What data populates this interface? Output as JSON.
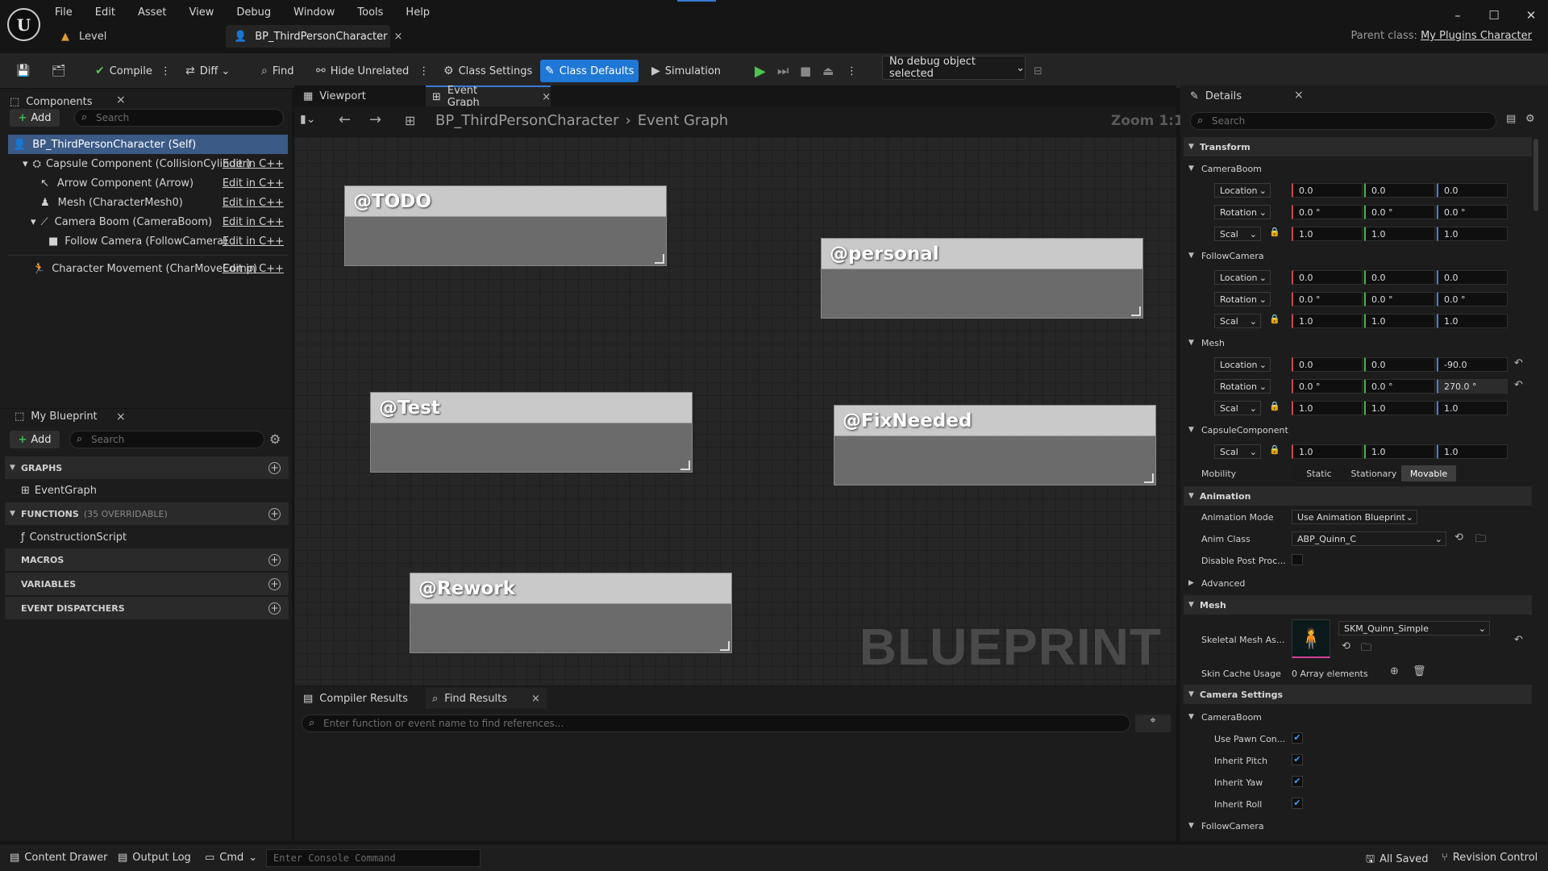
{
  "app": {
    "logo": "U"
  },
  "menu": [
    "File",
    "Edit",
    "Asset",
    "View",
    "Debug",
    "Window",
    "Tools",
    "Help"
  ],
  "doc_tabs": {
    "level": "Level",
    "blueprint": "BP_ThirdPersonCharacter"
  },
  "parent_class": {
    "label": "Parent class:",
    "value": "My Plugins Character"
  },
  "toolbar": {
    "compile": "Compile",
    "diff": "Diff",
    "find": "Find",
    "hide_unrelated": "Hide Unrelated",
    "class_settings": "Class Settings",
    "class_defaults": "Class Defaults",
    "simulation": "Simulation",
    "debug_object": "No debug object selected"
  },
  "components": {
    "tab": "Components",
    "add": "Add",
    "search_placeholder": "Search",
    "root": "BP_ThirdPersonCharacter (Self)",
    "items": [
      {
        "label": "Capsule Component (CollisionCylinder)",
        "edit": "Edit in C++"
      },
      {
        "label": "Arrow Component (Arrow)",
        "edit": "Edit in C++"
      },
      {
        "label": "Mesh (CharacterMesh0)",
        "edit": "Edit in C++"
      },
      {
        "label": "Camera Boom (CameraBoom)",
        "edit": "Edit in C++"
      },
      {
        "label": "Follow Camera (FollowCamera)",
        "edit": "Edit in C++"
      },
      {
        "label": "Character Movement (CharMoveComp)",
        "edit": "Edit in C++"
      }
    ]
  },
  "my_blueprint": {
    "tab": "My Blueprint",
    "add": "Add",
    "search_placeholder": "Search",
    "graphs": "GRAPHS",
    "event_graph": "EventGraph",
    "functions": "FUNCTIONS",
    "functions_note": "(35 OVERRIDABLE)",
    "construction_script": "ConstructionScript",
    "macros": "MACROS",
    "variables": "VARIABLES",
    "event_dispatchers": "EVENT DISPATCHERS"
  },
  "graph_tabs": {
    "viewport": "Viewport",
    "event_graph": "Event Graph"
  },
  "breadcrumb": {
    "bp": "BP_ThirdPersonCharacter",
    "graph": "Event Graph",
    "zoom": "Zoom 1:1"
  },
  "comments": [
    "@TODO",
    "@personal",
    "@Test",
    "@FixNeeded",
    "@Rework"
  ],
  "watermark": "BLUEPRINT",
  "bottom_tabs": {
    "compiler": "Compiler Results",
    "find": "Find Results",
    "find_placeholder": "Enter function or event name to find references..."
  },
  "details": {
    "tab": "Details",
    "search_placeholder": "Search",
    "transform": "Transform",
    "camera_boom": "CameraBoom",
    "follow_camera": "FollowCamera",
    "mesh": "Mesh",
    "capsule": "CapsuleComponent",
    "location": "Location",
    "rotation": "Rotation",
    "scale": "Scal",
    "cb_loc": [
      "0.0",
      "0.0",
      "0.0"
    ],
    "cb_rot": [
      "0.0 °",
      "0.0 °",
      "0.0 °"
    ],
    "cb_scl": [
      "1.0",
      "1.0",
      "1.0"
    ],
    "fc_loc": [
      "0.0",
      "0.0",
      "0.0"
    ],
    "fc_rot": [
      "0.0 °",
      "0.0 °",
      "0.0 °"
    ],
    "fc_scl": [
      "1.0",
      "1.0",
      "1.0"
    ],
    "m_loc": [
      "0.0",
      "0.0",
      "-90.0"
    ],
    "m_rot": [
      "0.0 °",
      "0.0 °",
      "270.0 °"
    ],
    "m_scl": [
      "1.0",
      "1.0",
      "1.0"
    ],
    "c_scl": [
      "1.0",
      "1.0",
      "1.0"
    ],
    "mobility": "Mobility",
    "mobility_opts": [
      "Static",
      "Stationary",
      "Movable"
    ],
    "animation": "Animation",
    "anim_mode_label": "Animation Mode",
    "anim_mode": "Use Animation Blueprint",
    "anim_class_label": "Anim Class",
    "anim_class": "ABP_Quinn_C",
    "disable_post": "Disable Post Proc...",
    "advanced": "Advanced",
    "mesh_sec": "Mesh",
    "skeletal_label": "Skeletal Mesh As...",
    "skeletal_value": "SKM_Quinn_Simple",
    "skin_cache_label": "Skin Cache Usage",
    "skin_cache_value": "0 Array elements",
    "camera_settings": "Camera Settings",
    "cs_boom": "CameraBoom",
    "use_pawn": "Use Pawn Con...",
    "inherit_pitch": "Inherit Pitch",
    "inherit_yaw": "Inherit Yaw",
    "inherit_roll": "Inherit Roll",
    "cs_follow": "FollowCamera"
  },
  "statusbar": {
    "content_drawer": "Content Drawer",
    "output_log": "Output Log",
    "cmd": "Cmd",
    "console_placeholder": "Enter Console Command",
    "all_saved": "All Saved",
    "revision": "Revision Control"
  }
}
